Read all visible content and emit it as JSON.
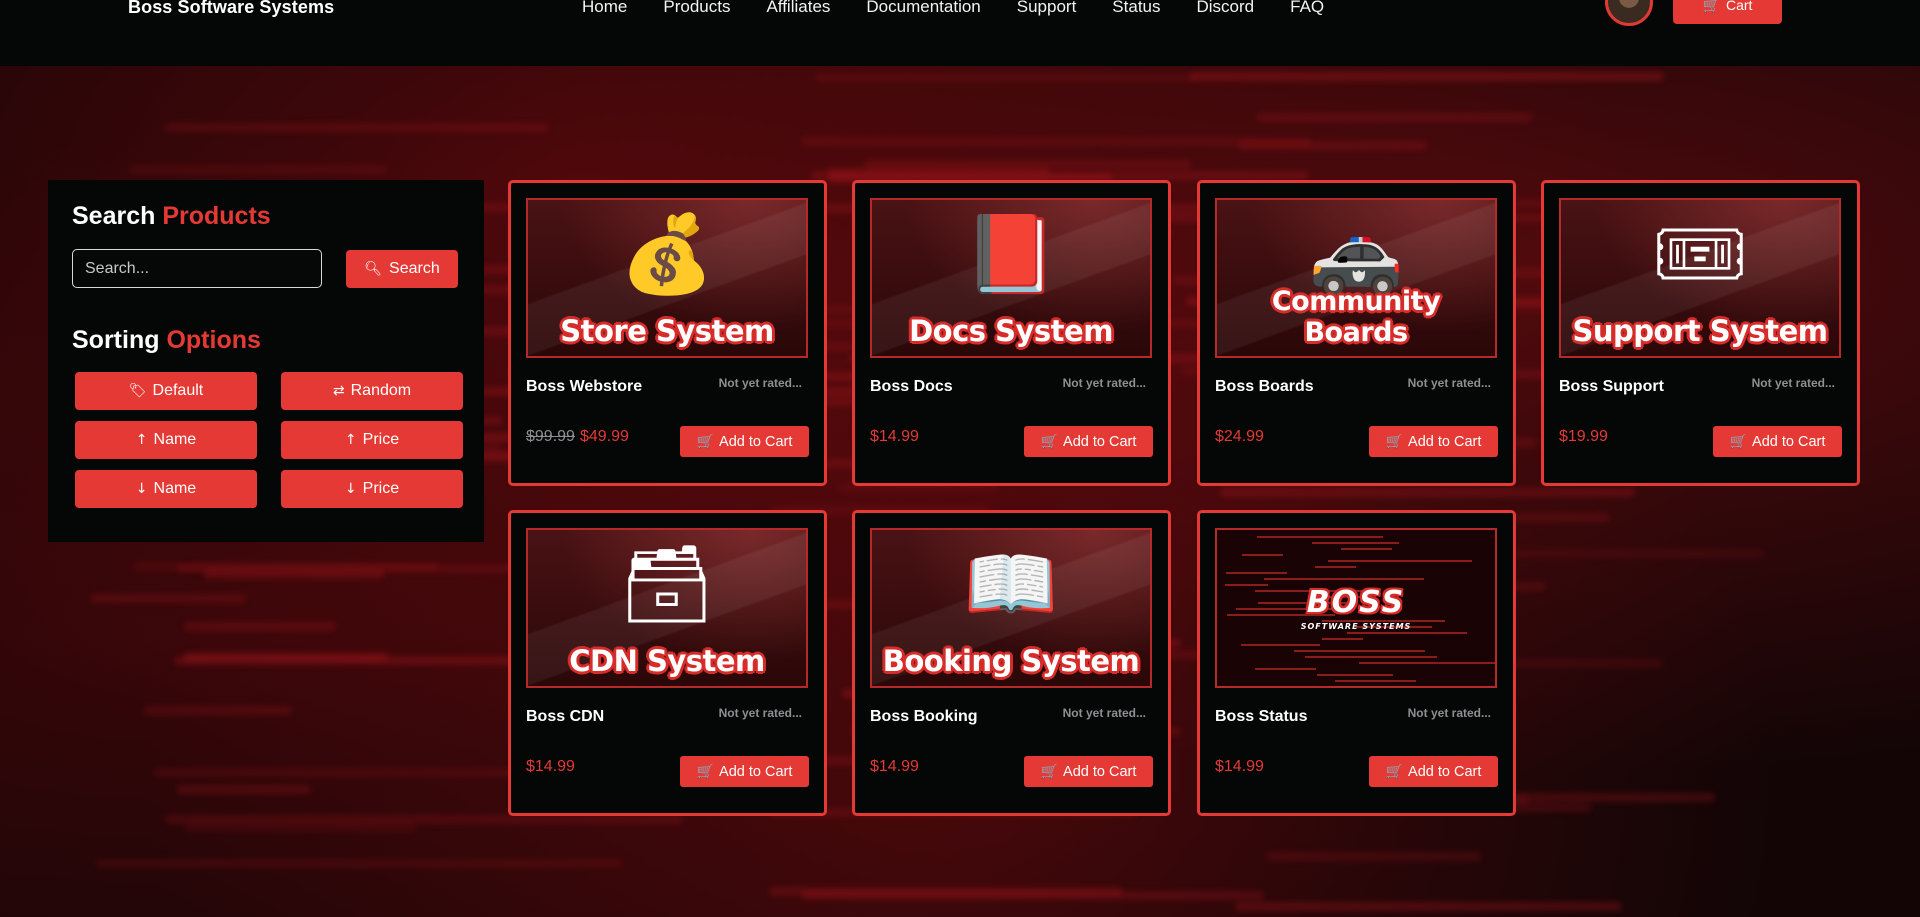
{
  "header": {
    "brand": "Boss Software Systems",
    "nav": [
      "Home",
      "Products",
      "Affiliates",
      "Documentation",
      "Support",
      "Status",
      "Discord",
      "FAQ"
    ],
    "cart_label": "Cart"
  },
  "sidebar": {
    "search_title": "Search",
    "search_title_accent": "Products",
    "search_placeholder": "Search...",
    "search_button": "Search",
    "sort_title": "Sorting",
    "sort_title_accent": "Options",
    "sort_buttons": [
      {
        "label": "Default",
        "icon": "tag-icon"
      },
      {
        "label": "Random",
        "icon": "shuffle-icon"
      },
      {
        "label": "Name",
        "icon": "arrow-up-icon"
      },
      {
        "label": "Price",
        "icon": "arrow-up-icon"
      },
      {
        "label": "Name",
        "icon": "arrow-down-icon"
      },
      {
        "label": "Price",
        "icon": "arrow-down-icon"
      }
    ]
  },
  "products": [
    {
      "banner": "Store System",
      "icon": "money-bag-icon",
      "name": "Boss Webstore",
      "rating": "Not yet rated...",
      "old_price": "$99.99",
      "price": "$49.99",
      "button": "Add to Cart"
    },
    {
      "banner": "Docs System",
      "icon": "book-icon",
      "name": "Boss Docs",
      "rating": "Not yet rated...",
      "old_price": "",
      "price": "$14.99",
      "button": "Add to Cart"
    },
    {
      "banner": "Community Boards",
      "icon": "police-car-icon",
      "name": "Boss Boards",
      "rating": "Not yet rated...",
      "old_price": "",
      "price": "$24.99",
      "button": "Add to Cart"
    },
    {
      "banner": "Support System",
      "icon": "ticket-icon",
      "name": "Boss Support",
      "rating": "Not yet rated...",
      "old_price": "",
      "price": "$19.99",
      "button": "Add to Cart"
    },
    {
      "banner": "CDN System",
      "icon": "card-file-box-icon",
      "name": "Boss CDN",
      "rating": "Not yet rated...",
      "old_price": "",
      "price": "$14.99",
      "button": "Add to Cart"
    },
    {
      "banner": "Booking System",
      "icon": "open-book-icon",
      "name": "Boss Booking",
      "rating": "Not yet rated...",
      "old_price": "",
      "price": "$14.99",
      "button": "Add to Cart"
    },
    {
      "banner": "",
      "icon": "boss-logo",
      "logo_text": "BOSS",
      "logo_sub": "SOFTWARE SYSTEMS",
      "name": "Boss Status",
      "rating": "Not yet rated...",
      "old_price": "",
      "price": "$14.99",
      "button": "Add to Cart"
    }
  ],
  "colors": {
    "accent": "#e53935",
    "panel": "#050707",
    "muted": "#8d8f91"
  }
}
